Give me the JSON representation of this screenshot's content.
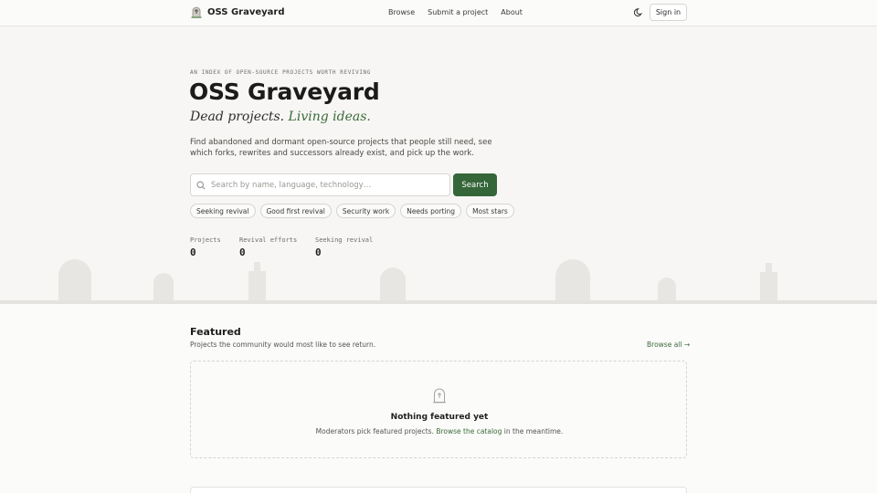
{
  "header": {
    "brand": "OSS Graveyard",
    "nav": [
      "Browse",
      "Submit a project",
      "About"
    ],
    "sign_in": "Sign in"
  },
  "hero": {
    "eyebrow": "AN INDEX OF OPEN-SOURCE PROJECTS WORTH REVIVING",
    "title": "OSS Graveyard",
    "tagline_a": "Dead projects.",
    "tagline_b": "Living ideas.",
    "description": "Find abandoned and dormant open-source projects that people still need, see which forks, rewrites and successors already exist, and pick up the work.",
    "search_placeholder": "Search by name, language, technology…",
    "search_button": "Search",
    "chips": [
      "Seeking revival",
      "Good first revival",
      "Security work",
      "Needs porting",
      "Most stars"
    ]
  },
  "stats": [
    {
      "label": "Projects",
      "value": "0"
    },
    {
      "label": "Revival efforts",
      "value": "0"
    },
    {
      "label": "Seeking revival",
      "value": "0"
    }
  ],
  "featured": {
    "title": "Featured",
    "subtitle": "Projects the community would most like to see return.",
    "browse_all": "Browse all →",
    "empty_title": "Nothing featured yet",
    "empty_text_a": "Moderators pick featured projects.",
    "empty_link": "Browse the catalog",
    "empty_text_b": "in the meantime."
  },
  "colors": {
    "accent": "#35663a",
    "accent_text": "#3b6b3a",
    "background": "#f7f6f4",
    "stone": "#e8e6e2"
  },
  "icons": [
    "gravestone-logo-icon",
    "moon-icon",
    "search-icon",
    "gravestone-icon"
  ]
}
